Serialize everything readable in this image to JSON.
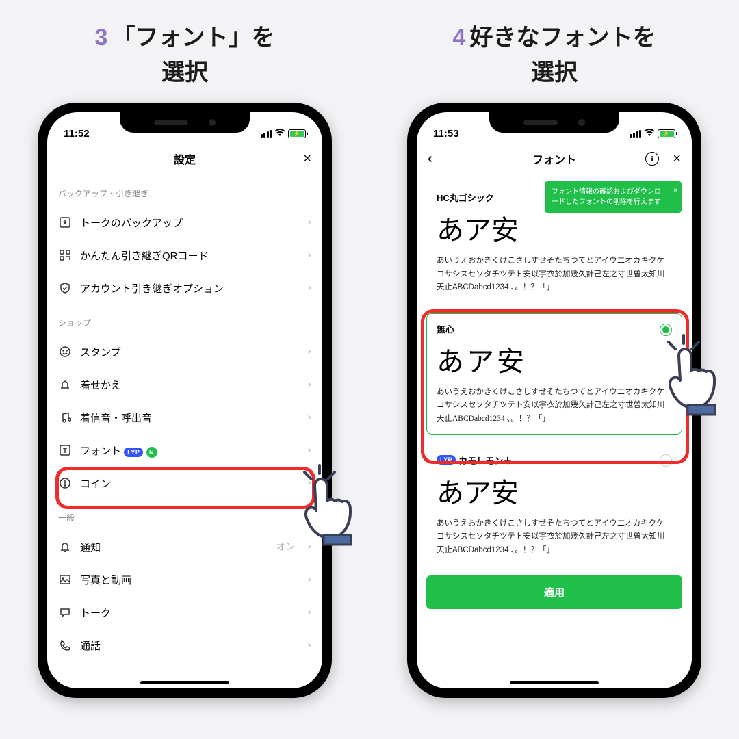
{
  "step3": {
    "num": "3",
    "title_line1": "「フォント」を",
    "title_line2": "選択"
  },
  "step4": {
    "num": "4",
    "title_line1": "好きなフォントを",
    "title_line2": "選択"
  },
  "status": {
    "time_left": "11:52",
    "time_right": "11:53"
  },
  "settings": {
    "title": "設定",
    "close": "×",
    "sec_backup": "バックアップ・引き継ぎ",
    "items_backup": [
      {
        "label": "トークのバックアップ"
      },
      {
        "label": "かんたん引き継ぎQRコード"
      },
      {
        "label": "アカウント引き継ぎオプション"
      }
    ],
    "sec_shop": "ショップ",
    "items_shop": [
      {
        "label": "スタンプ"
      },
      {
        "label": "着せかえ"
      },
      {
        "label": "着信音・呼出音"
      },
      {
        "label": "フォント",
        "lyp": "LYP",
        "n": "N"
      },
      {
        "label": "コイン"
      }
    ],
    "sec_general": "一般",
    "items_general": [
      {
        "label": "通知",
        "value": "オン"
      },
      {
        "label": "写真と動画"
      },
      {
        "label": "トーク"
      },
      {
        "label": "通話"
      }
    ]
  },
  "fonts": {
    "title": "フォント",
    "close": "×",
    "back": "‹",
    "tip": "フォント情報の確認およびダウンロードしたフォントの削除を行えます",
    "cards": [
      {
        "name": "HC丸ゴシック",
        "preview": "あア安",
        "sample": "あいうえおかきくけこさしすせそたちつてとアイウエオカキクケコサシスセソタチツテト安以宇衣於加幾久計己左之寸世曽太知川天止ABCDabcd1234 、。！？「」"
      },
      {
        "name": "無心",
        "preview": "あア安",
        "sample": "あいうえおかきくけこさしすせそたちつてとアイウエオカキクケコサシスセソタチツテト安以宇衣於加幾久計己左之寸世曽太知川天止ABCDabcd1234 、。！？「」",
        "selected": true
      },
      {
        "name": "カモレモン＋",
        "lyp": "LYP",
        "preview": "あア安",
        "sample": "あいうえおかきくけこさしすせそたちつてとアイウエオカキクケコサシスセソタチツテト安以宇衣於加幾久計己左之寸世曽太知川天止ABCDabcd1234 、。！？「」"
      }
    ],
    "apply": "適用"
  }
}
